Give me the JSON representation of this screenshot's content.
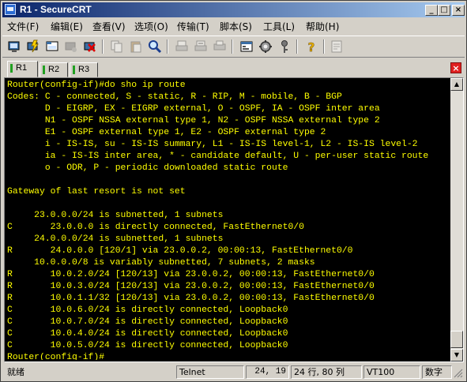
{
  "window": {
    "title": "R1 - SecureCRT",
    "min_label": "_",
    "max_label": "□",
    "close_label": "×"
  },
  "menu": [
    "文件(F)",
    "编辑(E)",
    "查看(V)",
    "选项(O)",
    "传输(T)",
    "脚本(S)",
    "工具(L)",
    "帮助(H)"
  ],
  "tabs": [
    "R1",
    "R2",
    "R3"
  ],
  "tab_close_label": "×",
  "colors": {
    "terminal_bg": "#000000",
    "terminal_fg": "#ffff00",
    "title_start": "#0a246a",
    "title_end": "#a6caf0",
    "tab_mark": "#21a021"
  },
  "terminal": {
    "lines": [
      "Router(config-if)#do sho ip route",
      "Codes: C - connected, S - static, R - RIP, M - mobile, B - BGP",
      "       D - EIGRP, EX - EIGRP external, O - OSPF, IA - OSPF inter area",
      "       N1 - OSPF NSSA external type 1, N2 - OSPF NSSA external type 2",
      "       E1 - OSPF external type 1, E2 - OSPF external type 2",
      "       i - IS-IS, su - IS-IS summary, L1 - IS-IS level-1, L2 - IS-IS level-2",
      "       ia - IS-IS inter area, * - candidate default, U - per-user static route",
      "       o - ODR, P - periodic downloaded static route",
      "",
      "Gateway of last resort is not set",
      "",
      "     23.0.0.0/24 is subnetted, 1 subnets",
      "C       23.0.0.0 is directly connected, FastEthernet0/0",
      "     24.0.0.0/24 is subnetted, 1 subnets",
      "R       24.0.0.0 [120/1] via 23.0.0.2, 00:00:13, FastEthernet0/0",
      "     10.0.0.0/8 is variably subnetted, 7 subnets, 2 masks",
      "R       10.0.2.0/24 [120/13] via 23.0.0.2, 00:00:13, FastEthernet0/0",
      "R       10.0.3.0/24 [120/13] via 23.0.0.2, 00:00:13, FastEthernet0/0",
      "R       10.0.1.1/32 [120/13] via 23.0.0.2, 00:00:13, FastEthernet0/0",
      "C       10.0.6.0/24 is directly connected, Loopback0",
      "C       10.0.7.0/24 is directly connected, Loopback0",
      "C       10.0.4.0/24 is directly connected, Loopback0",
      "C       10.0.5.0/24 is directly connected, Loopback0",
      "Router(config-if)#"
    ]
  },
  "toolbar_icons": [
    "connect-icon",
    "quick-connect-icon",
    "connect-in-tab-icon",
    "reconnect-icon",
    "disconnect-icon",
    "copy-icon",
    "paste-icon",
    "find-icon",
    "print-icon",
    "print-selection-icon",
    "print-setup-icon",
    "session-options-icon",
    "global-options-icon",
    "keymap-icon",
    "help-icon",
    "log-icon"
  ],
  "status": {
    "ready": "就绪",
    "protocol": "Telnet",
    "position": "24, 19",
    "size": "24 行, 80 列",
    "emulation": "VT100",
    "numlock": "数字"
  }
}
